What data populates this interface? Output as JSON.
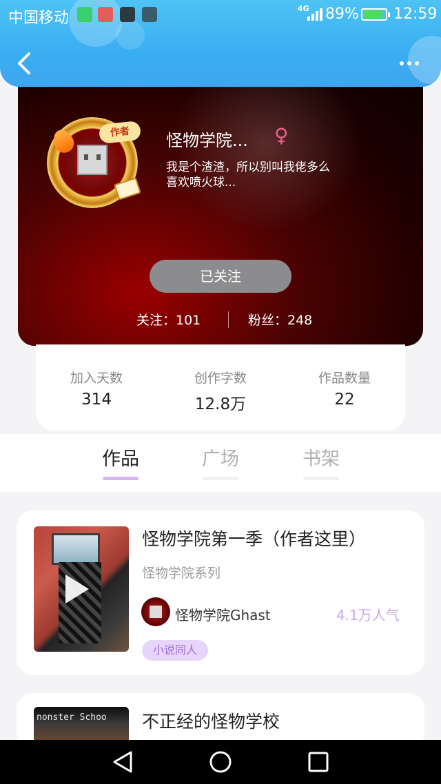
{
  "status_bar": {
    "carrier": "中国移动",
    "network": "4G",
    "battery_percent": "89%",
    "battery_level": 0.89,
    "time": "12:59"
  },
  "header": {
    "back_icon": "chevron-left-icon",
    "more_icon": "more-horizontal-icon"
  },
  "profile": {
    "avatar_badge": "作者",
    "name": "怪物学院...",
    "gender_symbol": "♀",
    "bio": "我是个渣渣，所以别叫我佬多么喜欢喷火球...",
    "follow_button": "已关注",
    "following": "关注：101",
    "fans": "粉丝：248"
  },
  "stats": [
    {
      "label": "加入天数",
      "value": "314"
    },
    {
      "label": "创作字数",
      "value": "12.8万"
    },
    {
      "label": "作品数量",
      "value": "22"
    }
  ],
  "tabs": [
    {
      "label": "作品",
      "active": true
    },
    {
      "label": "广场",
      "active": false
    },
    {
      "label": "书架",
      "active": false
    }
  ],
  "works": [
    {
      "title": "怪物学院第一季（作者这里）",
      "series": "怪物学院系列",
      "author": "怪物学院Ghast",
      "popularity": "4.1万人气",
      "tag": "小说同人"
    },
    {
      "title": "不正经的怪物学校",
      "cover_text": "nonster Schoo"
    }
  ],
  "colors": {
    "header_blue": "#3aaef2",
    "accent_purple": "#c9a7ec",
    "tag_bg": "#e8d6fa",
    "gender_pink": "#e7638a"
  }
}
